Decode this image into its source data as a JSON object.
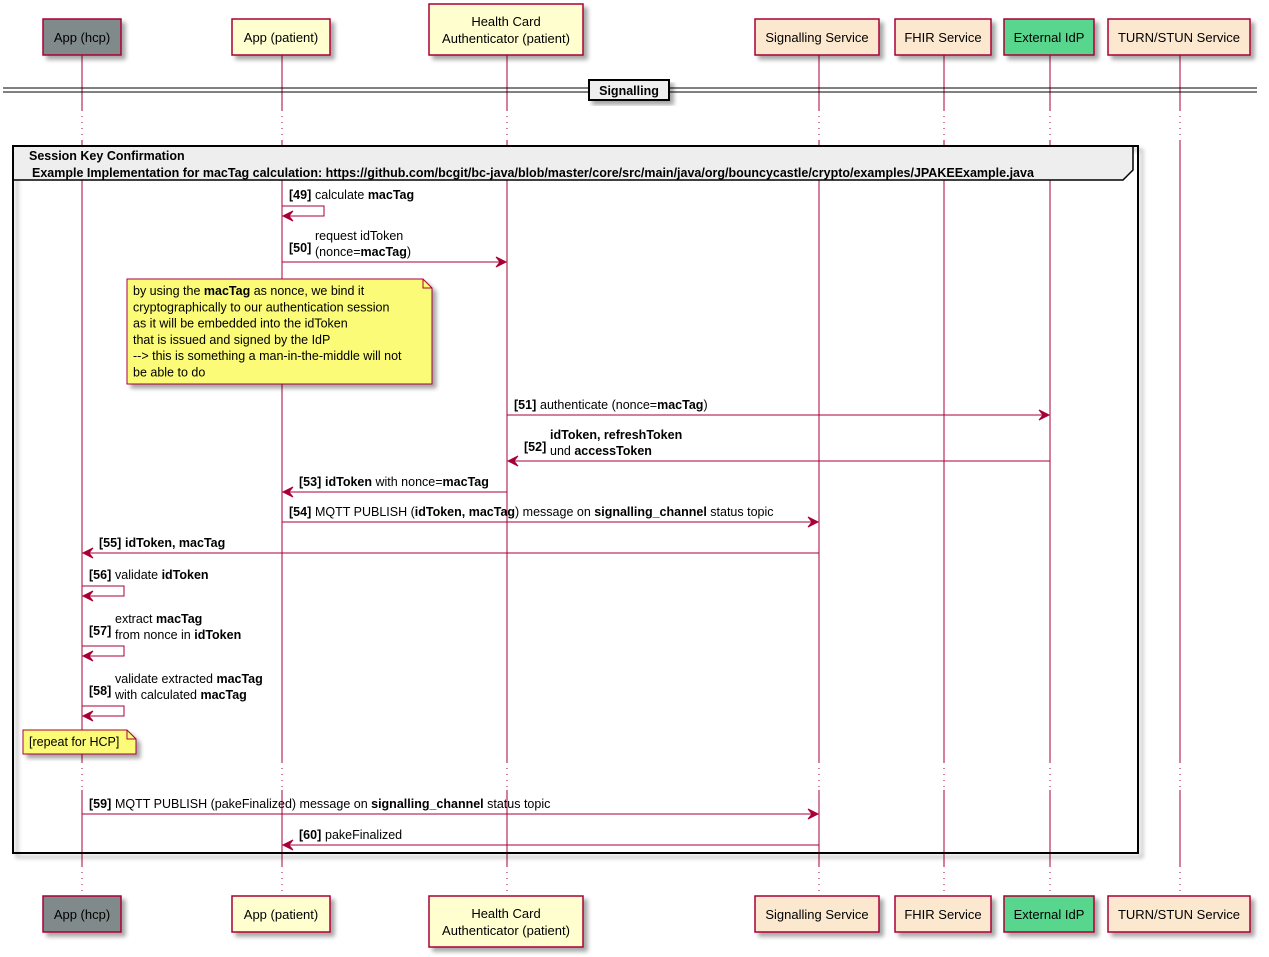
{
  "participants": [
    {
      "id": "hcp",
      "lines": [
        "App (hcp)"
      ],
      "fill": "#808A8A"
    },
    {
      "id": "patient",
      "lines": [
        "App (patient)"
      ],
      "fill": "#FEFECE"
    },
    {
      "id": "hca",
      "lines": [
        "Health Card",
        "Authenticator (patient)"
      ],
      "fill": "#FEFECE"
    },
    {
      "id": "signalling",
      "lines": [
        "Signalling Service"
      ],
      "fill": "#FCE8CF"
    },
    {
      "id": "fhir",
      "lines": [
        "FHIR Service"
      ],
      "fill": "#FCE8CF"
    },
    {
      "id": "idp",
      "lines": [
        "External IdP"
      ],
      "fill": "#58D68D"
    },
    {
      "id": "turn",
      "lines": [
        "TURN/STUN Service"
      ],
      "fill": "#FCE8CF"
    }
  ],
  "colors": {
    "lifeline": "#A80036",
    "arrow": "#A80036",
    "border": "#A80036",
    "note_fill": "#FBFB77",
    "group_header_fill": "#EEEEEE",
    "divider_fill": "#EEEEEE"
  },
  "divider": {
    "label": "Signalling"
  },
  "group": {
    "title": "Session Key Confirmation",
    "subtitle": "Example Implementation for macTag calculation: https://github.com/bcgit/bc-java/blob/master/core/src/main/java/org/bouncycastle/crypto/examples/JPAKEExample.java"
  },
  "messages": [
    {
      "num": "[49]",
      "from": "patient",
      "to": "patient",
      "lines": [
        [
          {
            "t": "calculate "
          },
          {
            "t": "macTag",
            "b": true
          }
        ]
      ]
    },
    {
      "num": "[50]",
      "from": "patient",
      "to": "hca",
      "lines": [
        [
          {
            "t": "request idToken"
          }
        ],
        [
          {
            "t": "(nonce="
          },
          {
            "t": "macTag",
            "b": true
          },
          {
            "t": ")"
          }
        ]
      ]
    },
    {
      "num": "[51]",
      "from": "hca",
      "to": "idp",
      "lines": [
        [
          {
            "t": "authenticate (nonce="
          },
          {
            "t": "macTag",
            "b": true
          },
          {
            "t": ")"
          }
        ]
      ]
    },
    {
      "num": "[52]",
      "from": "idp",
      "to": "hca",
      "lines": [
        [
          {
            "t": "idToken, refreshToken",
            "b": true
          }
        ],
        [
          {
            "t": "und "
          },
          {
            "t": "accessToken",
            "b": true
          }
        ]
      ]
    },
    {
      "num": "[53]",
      "from": "hca",
      "to": "patient",
      "lines": [
        [
          {
            "t": "idToken",
            "b": true
          },
          {
            "t": " with nonce="
          },
          {
            "t": "macTag",
            "b": true
          }
        ]
      ]
    },
    {
      "num": "[54]",
      "from": "patient",
      "to": "signalling",
      "lines": [
        [
          {
            "t": "MQTT PUBLISH ("
          },
          {
            "t": "idToken, macTag",
            "b": true
          },
          {
            "t": ") message on "
          },
          {
            "t": "signalling_channel",
            "b": true
          },
          {
            "t": " status topic"
          }
        ]
      ]
    },
    {
      "num": "[55]",
      "from": "signalling",
      "to": "hcp",
      "lines": [
        [
          {
            "t": "idToken, macTag",
            "b": true
          }
        ]
      ]
    },
    {
      "num": "[56]",
      "from": "hcp",
      "to": "hcp",
      "lines": [
        [
          {
            "t": "validate "
          },
          {
            "t": "idToken",
            "b": true
          }
        ]
      ]
    },
    {
      "num": "[57]",
      "from": "hcp",
      "to": "hcp",
      "lines": [
        [
          {
            "t": "extract "
          },
          {
            "t": "macTag",
            "b": true
          }
        ],
        [
          {
            "t": "from nonce in "
          },
          {
            "t": "idToken",
            "b": true
          }
        ]
      ]
    },
    {
      "num": "[58]",
      "from": "hcp",
      "to": "hcp",
      "lines": [
        [
          {
            "t": "validate extracted "
          },
          {
            "t": "macTag",
            "b": true
          }
        ],
        [
          {
            "t": "with calculated "
          },
          {
            "t": "macTag",
            "b": true
          }
        ]
      ]
    },
    {
      "num": "[59]",
      "from": "hcp",
      "to": "signalling",
      "lines": [
        [
          {
            "t": "MQTT PUBLISH (pakeFinalized) message on "
          },
          {
            "t": "signalling_channel",
            "b": true
          },
          {
            "t": " status topic"
          }
        ]
      ]
    },
    {
      "num": "[60]",
      "from": "signalling",
      "to": "patient",
      "lines": [
        [
          {
            "t": "pakeFinalized"
          }
        ]
      ]
    }
  ],
  "notes": [
    {
      "id": "nonce-binding-note",
      "lines": [
        [
          {
            "t": "by using the "
          },
          {
            "t": "macTag",
            "b": true
          },
          {
            "t": " as nonce, we bind it"
          }
        ],
        [
          {
            "t": "cryptographically to our authentication session"
          }
        ],
        [
          {
            "t": "as it will be embedded into the idToken"
          }
        ],
        [
          {
            "t": "that is issued and signed by the IdP"
          }
        ],
        [
          {
            "t": "--> this is something a man-in-the-middle will not"
          }
        ],
        [
          {
            "t": "be able to do"
          }
        ]
      ]
    },
    {
      "id": "repeat-note",
      "lines": [
        [
          {
            "t": "[repeat for HCP]"
          }
        ]
      ]
    }
  ]
}
